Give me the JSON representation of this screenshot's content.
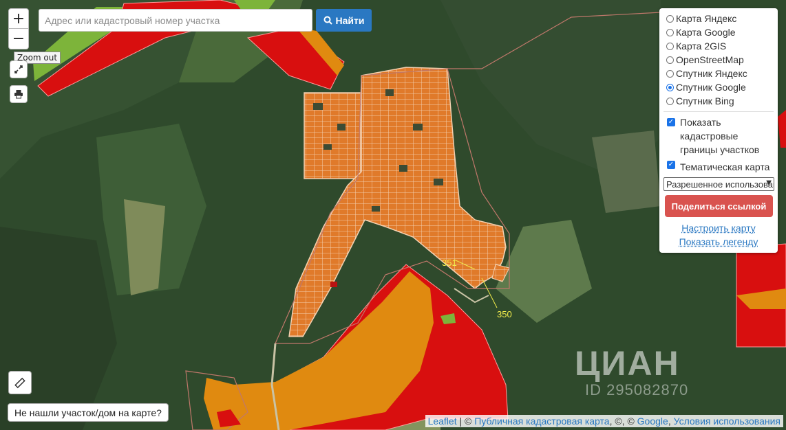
{
  "search": {
    "placeholder": "Адрес или кадастровый номер участка",
    "button_label": "Найти"
  },
  "zoom": {
    "in_label": "+",
    "out_label": "−",
    "tooltip": "Zoom out"
  },
  "layers": {
    "items": [
      {
        "label": "Карта Яндекс",
        "selected": false
      },
      {
        "label": "Карта Google",
        "selected": false
      },
      {
        "label": "Карта 2GIS",
        "selected": false
      },
      {
        "label": "OpenStreetMap",
        "selected": false
      },
      {
        "label": "Спутник Яндекс",
        "selected": false
      },
      {
        "label": "Спутник Google",
        "selected": true
      },
      {
        "label": "Спутник Bing",
        "selected": false
      }
    ],
    "show_cadastral_label": "Показать кадастровые границы участков",
    "show_cadastral_checked": true,
    "thematic_label": "Тематическая карта",
    "thematic_checked": true,
    "select_value": "Разрешенное использование",
    "share_button": "Поделиться ссылкой",
    "configure_link": "Настроить карту",
    "legend_link": "Показать легенду"
  },
  "not_found_button": "Не нашли участок/дом на карте?",
  "map_labels": {
    "plot_351": "351",
    "plot_350": "350"
  },
  "attribution": {
    "leaflet": "Leaflet",
    "separator": "|",
    "copy1": "©",
    "pkk": "Публичная кадастровая карта",
    "copy2": ", ©, ©",
    "google": "Google",
    "comma": ",",
    "terms": "Условия использования"
  },
  "watermark": {
    "brand": "ЦИАН",
    "id": "ID 295082870"
  },
  "colors": {
    "satellite_forest": "#2f4a2c",
    "zone_red": "#d80f0f",
    "zone_orange": "#e08a10",
    "zone_green": "#7db43a",
    "plots": "#e07a2a",
    "label_yellow": "#f2ec4b",
    "button_blue": "#2a78c2",
    "share_red": "#d9534f"
  }
}
